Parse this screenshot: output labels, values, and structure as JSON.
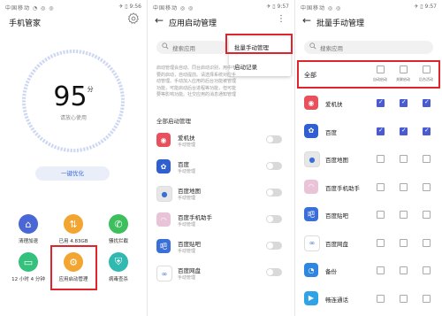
{
  "status": {
    "p1_left": "中国移动 ◔ ◎ ◎",
    "p1_right": "✈ ▯ 9:56",
    "p2_left": "中国移动 ◎ ◎",
    "p2_right": "✈ ▯ 9:57",
    "p3_left": "中国移动 ◎ ◎",
    "p3_right": "✈ ▯ 9:57"
  },
  "phone1": {
    "title": "手机管家",
    "score": "95",
    "score_unit": "分",
    "hint": "请放心使用",
    "optimize_label": "一键优化",
    "tools": [
      {
        "label": "清理加速",
        "icon": "broom-icon",
        "color": "#4b67d6"
      },
      {
        "label": "已用 4.83GB",
        "icon": "data-usage-icon",
        "color": "#f2a531"
      },
      {
        "label": "骚扰拦截",
        "icon": "phone-block-icon",
        "color": "#3cbf5c"
      },
      {
        "label": "12 小时 4 分钟",
        "icon": "battery-icon",
        "color": "#34c17b"
      },
      {
        "label": "应用启动管理",
        "icon": "app-launch-icon",
        "color": "#f2a531"
      },
      {
        "label": "病毒查杀",
        "icon": "shield-icon",
        "color": "#2fb9b0"
      }
    ]
  },
  "phone2": {
    "title": "应用启动管理",
    "search_placeholder": "搜索应用",
    "popup_items": [
      "批量手动管理",
      "启动记录"
    ],
    "description": "启动管理会自动、同台启动识别，用中不要的启动，自动提前。请选择系统对应手动管理。手动加入应用的后台功能被管理功能，可能启动后台进程等功能，但可能要等影响功能。社交应用的消息通知管理",
    "section_title": "全部启动管理",
    "apps": [
      {
        "name": "爱机扶",
        "sub": "手动管理",
        "icon": "aijifu-icon",
        "color": "#e8505b",
        "glyph": "◉"
      },
      {
        "name": "百度",
        "sub": "手动管理",
        "icon": "baidu-paw-icon",
        "color": "#2f5fd0",
        "glyph": "✿"
      },
      {
        "name": "百度地图",
        "sub": "手动管理",
        "icon": "map-pin-icon",
        "color": "#e7e7e7",
        "glyph": "●"
      },
      {
        "name": "百度手机助手",
        "sub": "手动管理",
        "icon": "shopping-bag-icon",
        "color": "#e9c3d8",
        "glyph": "◠"
      },
      {
        "name": "百度贴吧",
        "sub": "手动管理",
        "icon": "tieba-icon",
        "color": "#3a6fd8",
        "glyph": "吧"
      },
      {
        "name": "百度网盘",
        "sub": "手动管理",
        "icon": "cloud-disk-icon",
        "color": "#ffffff",
        "glyph": "∞"
      }
    ]
  },
  "phone3": {
    "title": "批量手动管理",
    "search_placeholder": "搜索应用",
    "all_label": "全部",
    "col_headers": [
      "自动启动",
      "关联启动",
      "后台活动"
    ],
    "apps": [
      {
        "name": "爱机扶",
        "icon": "aijifu-icon",
        "color": "#e8505b",
        "glyph": "◉",
        "checks": [
          true,
          true,
          true
        ]
      },
      {
        "name": "百度",
        "icon": "baidu-paw-icon",
        "color": "#2f5fd0",
        "glyph": "✿",
        "checks": [
          true,
          true,
          true
        ]
      },
      {
        "name": "百度地图",
        "icon": "map-pin-icon",
        "color": "#e7e7e7",
        "glyph": "●",
        "checks": [
          false,
          false,
          false
        ]
      },
      {
        "name": "百度手机助手",
        "icon": "shopping-bag-icon",
        "color": "#e9c3d8",
        "glyph": "◠",
        "checks": [
          false,
          false,
          false
        ]
      },
      {
        "name": "百度贴吧",
        "icon": "tieba-icon",
        "color": "#3a6fd8",
        "glyph": "吧",
        "checks": [
          false,
          false,
          false
        ]
      },
      {
        "name": "百度网盘",
        "icon": "cloud-disk-icon",
        "color": "#ffffff",
        "glyph": "∞",
        "checks": [
          false,
          false,
          false
        ]
      },
      {
        "name": "备份",
        "icon": "backup-icon",
        "color": "#2f86e0",
        "glyph": "◔",
        "checks": [
          false,
          false,
          false
        ]
      },
      {
        "name": "畅连通话",
        "icon": "video-call-icon",
        "color": "#2fa3e6",
        "glyph": "▶",
        "checks": [
          false,
          false,
          false
        ]
      }
    ]
  },
  "colors": {
    "highlight": "#e0242e",
    "accent": "#4a5bd2"
  }
}
